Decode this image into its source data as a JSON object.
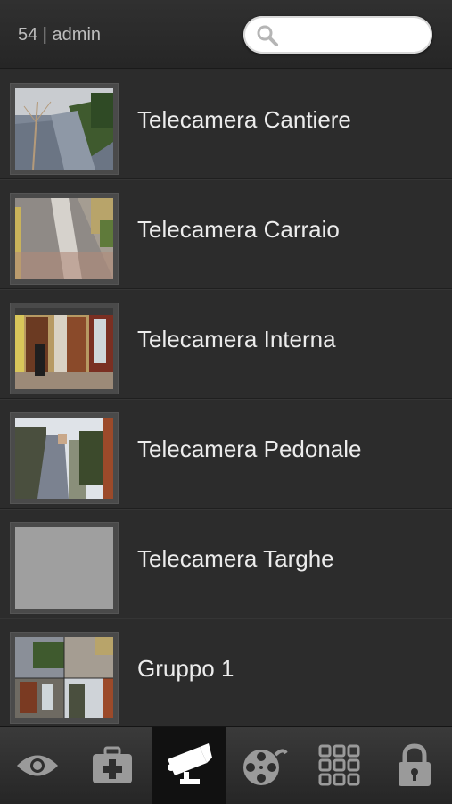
{
  "header": {
    "user_text": "54 | admin",
    "search_placeholder": ""
  },
  "cameras": [
    {
      "label": "Telecamera Cantiere",
      "thumb": "outdoor-yard"
    },
    {
      "label": "Telecamera Carraio",
      "thumb": "driveway"
    },
    {
      "label": "Telecamera Interna",
      "thumb": "interior-doors"
    },
    {
      "label": "Telecamera Pedonale",
      "thumb": "walkway"
    },
    {
      "label": "Telecamera Targhe",
      "thumb": "grey-blank"
    },
    {
      "label": "Gruppo 1",
      "thumb": "group-grid"
    }
  ],
  "tabbar": {
    "active_index": 2,
    "tabs": [
      {
        "icon": "eye-icon"
      },
      {
        "icon": "medical-kit-icon"
      },
      {
        "icon": "security-camera-icon"
      },
      {
        "icon": "film-reel-icon"
      },
      {
        "icon": "grid-icon"
      },
      {
        "icon": "lock-icon"
      }
    ]
  },
  "colors": {
    "background": "#2b2b2b",
    "text": "#ececec",
    "icon": "#9a9a9a",
    "active_tab": "#111111"
  }
}
